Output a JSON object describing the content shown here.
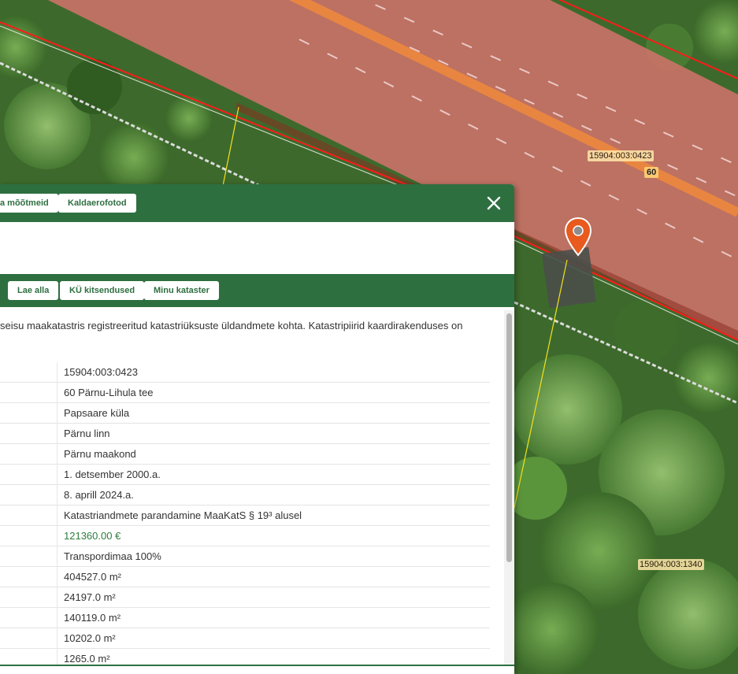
{
  "map": {
    "parcel_labels": [
      {
        "text": "15904:003:0423"
      },
      {
        "text": "15904:003:1340"
      }
    ],
    "house_number": "60",
    "colors": {
      "road_parcel_fill": "#d9736e",
      "boundary": "#ff1a1a",
      "road_centerline": "#f08a3c",
      "marker": "#e85a1e",
      "vegetation": "#3f6b2e"
    },
    "marker_icon": "map-pin-icon"
  },
  "panel": {
    "top_tabs": [
      {
        "label": "a mõõtmeid"
      },
      {
        "label": "Kaldaerofotod"
      }
    ],
    "close_icon": "close-icon",
    "actions": [
      {
        "label": "Lae alla"
      },
      {
        "label": "KÜ kitsendused"
      },
      {
        "label": "Minu kataster"
      }
    ],
    "intro_text": "seisu maakatastris registreeritud katastriüksuste üldandmete kohta. Katastripiirid kaardirakenduses on",
    "rows": [
      {
        "value": "15904:003:0423"
      },
      {
        "value": "60 Pärnu-Lihula tee"
      },
      {
        "value": "Papsaare küla"
      },
      {
        "value": "Pärnu linn"
      },
      {
        "value": "Pärnu maakond"
      },
      {
        "value": "1. detsember 2000.a."
      },
      {
        "value": "8. aprill 2024.a."
      },
      {
        "value": "Katastriandmete parandamine MaaKatS § 19³ alusel"
      },
      {
        "value": "121360.00 €"
      },
      {
        "value": "Transpordimaa 100%"
      },
      {
        "value": "404527.0 m²"
      },
      {
        "value": "24197.0 m²"
      },
      {
        "value": "140119.0 m²"
      },
      {
        "value": "10202.0 m²"
      },
      {
        "value": "1265.0 m²"
      }
    ],
    "theme_green": "#2e6f40"
  }
}
